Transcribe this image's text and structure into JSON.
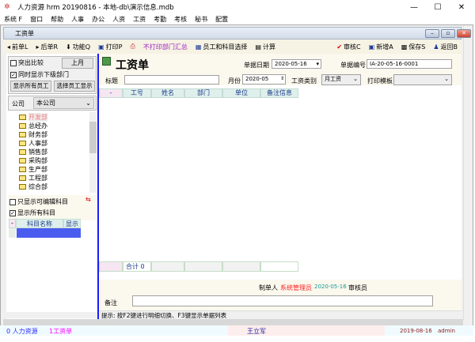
{
  "window": {
    "title": "人力资源 hrm 20190816 - 本地-db\\演示信息.mdb",
    "minimize": "—",
    "maximize": "☐",
    "close": "✕"
  },
  "menu": [
    "系统 F",
    "窗口",
    "帮助",
    "人事",
    "办公",
    "人资",
    "工资",
    "考勤",
    "考核",
    "秘书",
    "配置"
  ],
  "inner_window": {
    "title": "工资单"
  },
  "toolbar": {
    "prev": "前单L",
    "next": "后单R",
    "function": "功能Q",
    "print": "打印P",
    "no_print_summary": "不打印部门汇总",
    "employee_subject_select": "员工和科目选择",
    "calculate": "计算",
    "audit": "审核C",
    "add": "新增A",
    "save": "保存S",
    "back": "返回B"
  },
  "left": {
    "highlight_compare": "突出比较",
    "last_month": "上月",
    "show_sub_departments": "同时显示下级部门",
    "show_all_employees": "显示所有员工",
    "select_employee_display": "选择员工显示",
    "company_label": "公司",
    "company_value": "本公司",
    "tree": [
      "开发部",
      "总经办",
      "财务部",
      "人事部",
      "销售部",
      "采购部",
      "生产部",
      "工程部",
      "综合部"
    ],
    "only_editable_subjects": "只显示可编辑科目",
    "show_all_subjects": "显示所有科目",
    "subject_grid": {
      "corner": "-",
      "headers": [
        "科目名称",
        "显示"
      ]
    }
  },
  "form": {
    "heading": "工资单",
    "doc_date_label": "单据日期",
    "doc_date": "2020-05-16",
    "doc_no_label": "单据编号",
    "doc_no": "IA-20-05-16-0001",
    "title_label": "标题",
    "title_value": "",
    "month_label": "月份",
    "month": "2020-05",
    "salary_type_label": "工资类别",
    "salary_type": "月工资",
    "print_template_label": "打印模板",
    "print_template": ""
  },
  "grid": {
    "corner": "-",
    "headers": [
      "工号",
      "姓名",
      "部门",
      "单位",
      "备注信息"
    ],
    "total_label": "合计 0"
  },
  "footer": {
    "maker_label": "制单人",
    "maker": "系统管理员",
    "date": "2020-05-16",
    "auditor_label": "审核员",
    "remark_label": "备注",
    "hint": "提示:  按F2键进行明细切换、F3键显示单据列表"
  },
  "statusbar": {
    "tab0": "0 人力资源",
    "tab1": "1工资单",
    "user": "王立军",
    "date": "2019-08-16",
    "account": "admin"
  },
  "colors": {
    "accent_blue": "#1a1aff",
    "red": "#ff2020",
    "teal": "#1a9a9a",
    "magenta": "#ff00ff",
    "purple": "#a020c0"
  }
}
